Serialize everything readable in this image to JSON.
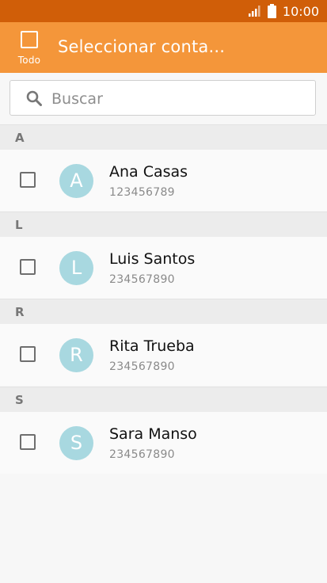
{
  "status_bar": {
    "time": "10:00",
    "icons": [
      "signal-icon",
      "battery-icon"
    ]
  },
  "app_bar": {
    "select_all_label": "Todo",
    "title": "Seleccionar conta..."
  },
  "search": {
    "placeholder": "Buscar",
    "value": ""
  },
  "sections": [
    {
      "letter": "A",
      "contacts": [
        {
          "initial": "A",
          "name": "Ana Casas",
          "phone": "123456789"
        }
      ]
    },
    {
      "letter": "L",
      "contacts": [
        {
          "initial": "L",
          "name": "Luis Santos",
          "phone": "234567890"
        }
      ]
    },
    {
      "letter": "R",
      "contacts": [
        {
          "initial": "R",
          "name": "Rita Trueba",
          "phone": "234567890"
        }
      ]
    },
    {
      "letter": "S",
      "contacts": [
        {
          "initial": "S",
          "name": "Sara Manso",
          "phone": "234567890"
        }
      ]
    }
  ],
  "colors": {
    "status_bar": "#d05e08",
    "app_bar": "#f4963a",
    "avatar": "#a8d8e0"
  }
}
